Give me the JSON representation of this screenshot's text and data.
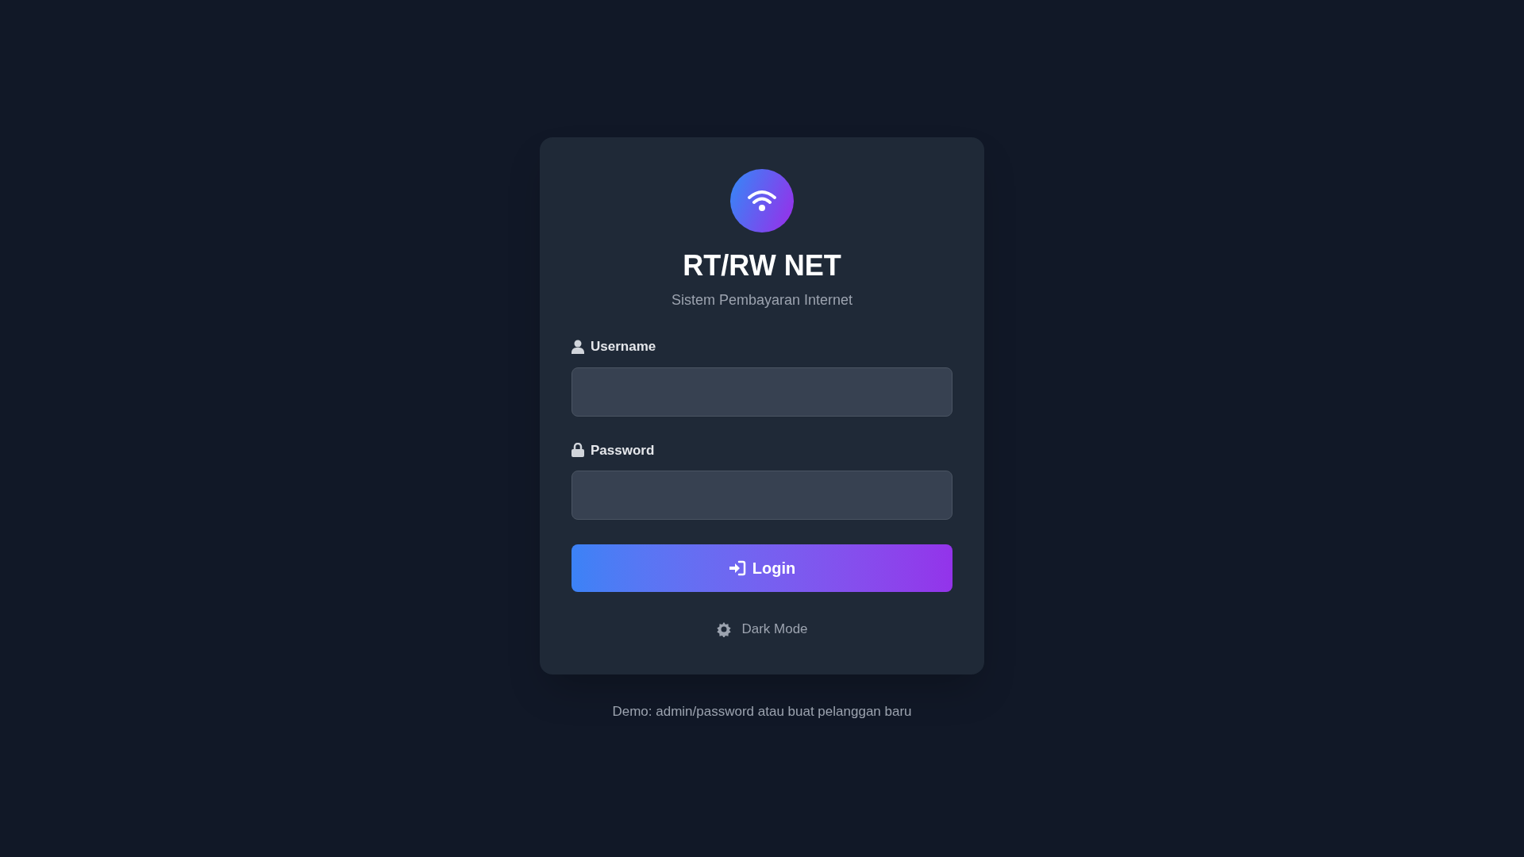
{
  "brand": {
    "title": "RT/RW NET",
    "subtitle": "Sistem Pembayaran Internet"
  },
  "fields": [
    {
      "kind": "username",
      "label": "Username"
    },
    {
      "kind": "password",
      "label": "Password"
    }
  ],
  "login_button": {
    "label": "Login"
  },
  "theme_toggle": {
    "label": "Dark Mode"
  },
  "footer_note": "Demo: admin/password atau buat pelanggan baru"
}
